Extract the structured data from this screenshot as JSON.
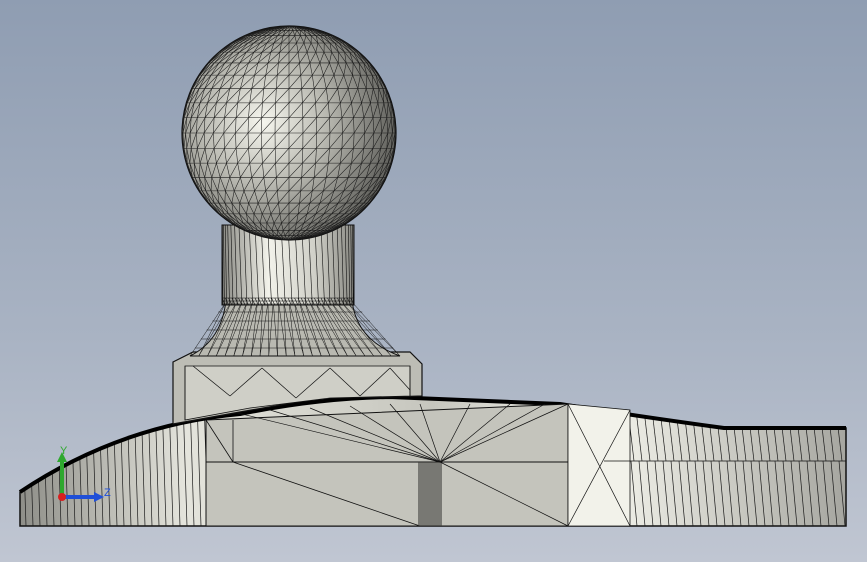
{
  "viewport": {
    "background_top": "#8f9db2",
    "background_bottom": "#c0c6d2",
    "mesh_color": "#1a1a1a",
    "surface_color": "#c8c8c0"
  },
  "model": {
    "parts": [
      "sphere-ball",
      "neck-cylinder",
      "fillet-flare",
      "hex-nut-base",
      "curved-plate-base"
    ]
  },
  "triad": {
    "y_label": "Y",
    "z_label": "Z",
    "y_color": "#2ea82e",
    "z_color": "#1f4fd8",
    "x_color": "#d81f1f"
  }
}
